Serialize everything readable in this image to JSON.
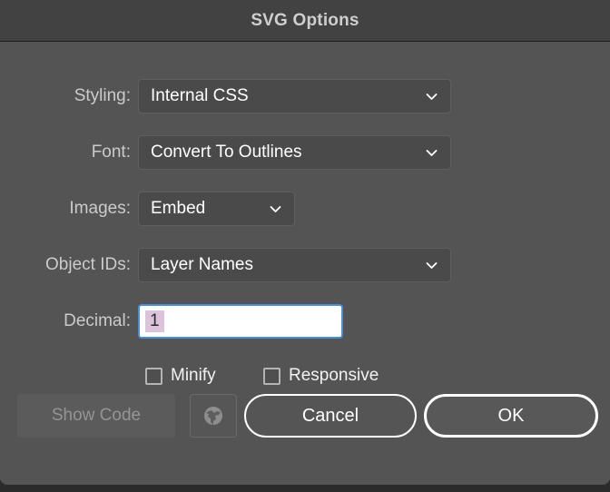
{
  "dialog": {
    "title": "SVG Options"
  },
  "fields": [
    {
      "label": "Styling:",
      "value": "Internal CSS",
      "name": "styling",
      "icon": "chevron-down-icon",
      "size": "wide"
    },
    {
      "label": "Font:",
      "value": "Convert To Outlines",
      "name": "font",
      "icon": "chevron-down-icon",
      "size": "wide"
    },
    {
      "label": "Images:",
      "value": "Embed",
      "name": "images",
      "icon": "chevron-down-icon",
      "size": "small"
    },
    {
      "label": "Object IDs:",
      "value": "Layer Names",
      "name": "object-ids",
      "icon": "chevron-down-icon",
      "size": "wide"
    }
  ],
  "decimal": {
    "label": "Decimal:",
    "value": "1",
    "selected": true
  },
  "checkboxes": [
    {
      "label": "Minify",
      "checked": false
    },
    {
      "label": "Responsive",
      "checked": false
    }
  ],
  "buttons": {
    "show_code": "Show Code",
    "show_code_disabled": true,
    "globe_icon": "globe-icon",
    "cancel": "Cancel",
    "ok": "OK",
    "default_button": "OK"
  },
  "colors": {
    "titlebar_bg": "#424242",
    "dialog_bg": "#545454",
    "control_bg": "#4a4a4a",
    "focus_border": "#4a90d9",
    "selection_highlight": "#dcc3dc",
    "label_text": "#cbcbcb",
    "value_text": "#ffffff",
    "disabled_text": "#949494"
  }
}
